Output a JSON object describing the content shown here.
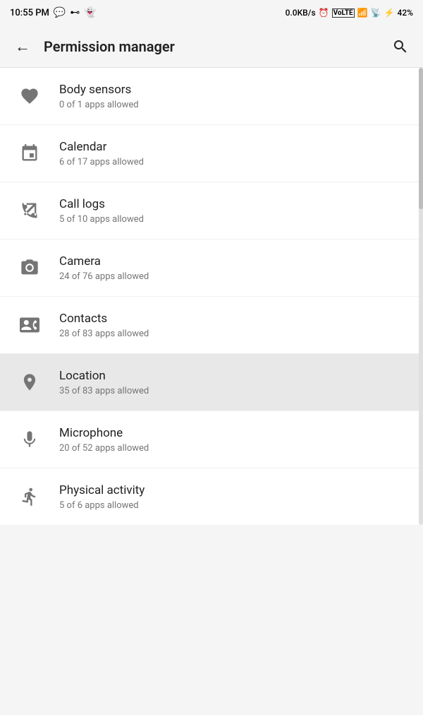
{
  "status_bar": {
    "time": "10:55 PM",
    "network_speed": "0.0KB/s",
    "battery": "42%"
  },
  "app_bar": {
    "title": "Permission manager",
    "back_label": "←",
    "search_label": "🔍"
  },
  "permissions": [
    {
      "id": "body-sensors",
      "name": "Body sensors",
      "desc": "0 of 1 apps allowed",
      "highlighted": false
    },
    {
      "id": "calendar",
      "name": "Calendar",
      "desc": "6 of 17 apps allowed",
      "highlighted": false
    },
    {
      "id": "call-logs",
      "name": "Call logs",
      "desc": "5 of 10 apps allowed",
      "highlighted": false
    },
    {
      "id": "camera",
      "name": "Camera",
      "desc": "24 of 76 apps allowed",
      "highlighted": false
    },
    {
      "id": "contacts",
      "name": "Contacts",
      "desc": "28 of 83 apps allowed",
      "highlighted": false
    },
    {
      "id": "location",
      "name": "Location",
      "desc": "35 of 83 apps allowed",
      "highlighted": true
    },
    {
      "id": "microphone",
      "name": "Microphone",
      "desc": "20 of 52 apps allowed",
      "highlighted": false
    },
    {
      "id": "physical-activity",
      "name": "Physical activity",
      "desc": "5 of 6 apps allowed",
      "highlighted": false
    }
  ]
}
